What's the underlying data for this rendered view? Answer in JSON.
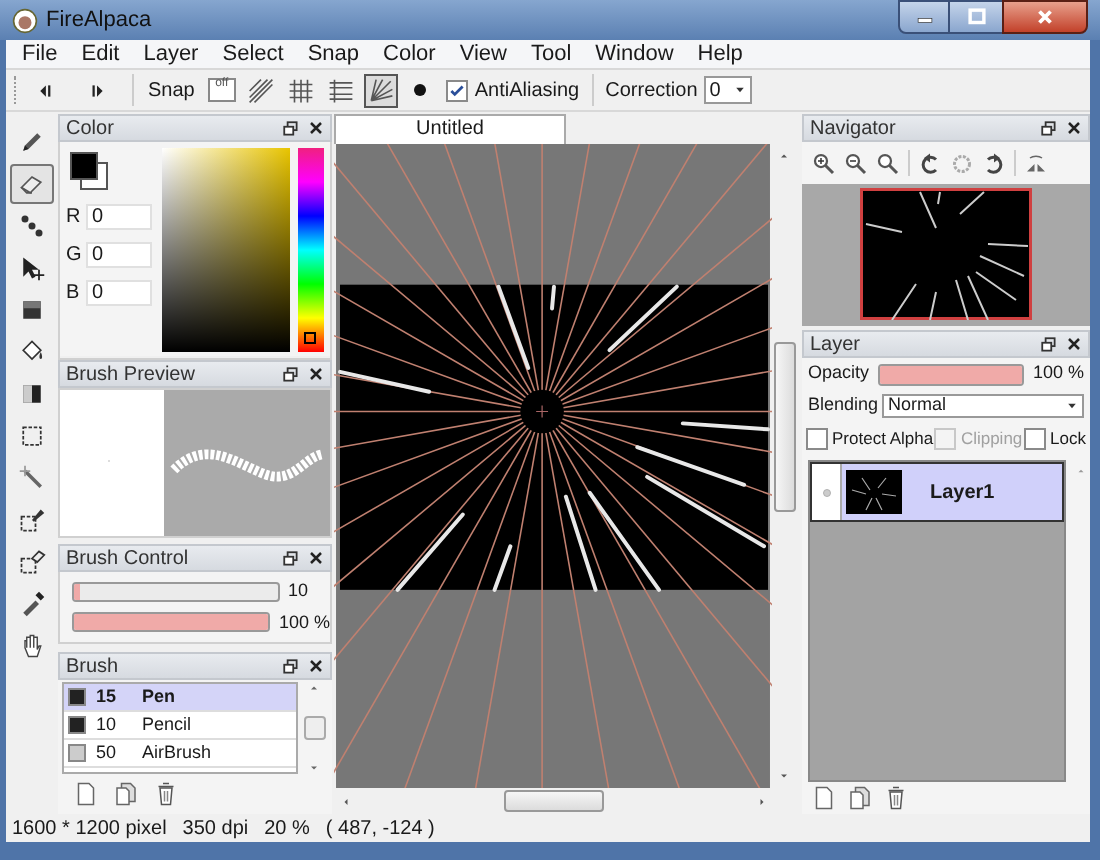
{
  "window": {
    "title": "FireAlpaca"
  },
  "menu": [
    "File",
    "Edit",
    "Layer",
    "Select",
    "Snap",
    "Color",
    "View",
    "Tool",
    "Window",
    "Help"
  ],
  "toolbar": {
    "snap_label": "Snap",
    "snap_modes": [
      {
        "kind": "off",
        "label": "off",
        "selected": false
      },
      {
        "kind": "parallel",
        "selected": false
      },
      {
        "kind": "grid",
        "selected": false
      },
      {
        "kind": "lines",
        "selected": false
      },
      {
        "kind": "radial",
        "selected": true
      }
    ],
    "antialiasing": {
      "label": "AntiAliasing",
      "checked": true
    },
    "correction": {
      "label": "Correction",
      "value": "0"
    }
  },
  "tools": [
    {
      "kind": "pen",
      "selected": false
    },
    {
      "kind": "eraser",
      "selected": true
    },
    {
      "kind": "dots",
      "selected": false
    },
    {
      "kind": "move",
      "selected": false
    },
    {
      "kind": "fill",
      "selected": false
    },
    {
      "kind": "bucket",
      "selected": false
    },
    {
      "kind": "gradient",
      "selected": false
    },
    {
      "kind": "select",
      "selected": false
    },
    {
      "kind": "wand",
      "selected": false
    },
    {
      "kind": "selectpen",
      "selected": false
    },
    {
      "kind": "selecteraser",
      "selected": false
    },
    {
      "kind": "eyedropper",
      "selected": false
    },
    {
      "kind": "hand",
      "selected": false
    }
  ],
  "color_panel": {
    "title": "Color",
    "hue": {
      "level": 0.07
    },
    "channels": [
      {
        "label": "R",
        "value": "0"
      },
      {
        "label": "G",
        "value": "0"
      },
      {
        "label": "B",
        "value": "0"
      }
    ]
  },
  "brush_preview": {
    "title": "Brush Preview"
  },
  "brush_control": {
    "title": "Brush Control",
    "sliders": [
      {
        "level": 0.03,
        "reading": "10"
      },
      {
        "level": 1,
        "reading": "100 %"
      }
    ]
  },
  "brush": {
    "title": "Brush",
    "items": [
      {
        "size": "15",
        "name": "Pen",
        "color": "#222222",
        "selected": true
      },
      {
        "size": "10",
        "name": "Pencil",
        "color": "#222222",
        "selected": false
      },
      {
        "size": "50",
        "name": "AirBrush",
        "color": "#cccccc",
        "selected": false
      }
    ]
  },
  "document_tab": {
    "title": "Untitled"
  },
  "navigator": {
    "title": "Navigator"
  },
  "layer_panel": {
    "title": "Layer",
    "opacity": {
      "label": "Opacity",
      "level": 1,
      "reading": "100 %"
    },
    "blending": {
      "label": "Blending",
      "value": "Normal"
    },
    "options": [
      {
        "label": "Protect Alpha",
        "checked": false,
        "disabled": false
      },
      {
        "label": "Clipping",
        "checked": false,
        "disabled": true
      },
      {
        "label": "Lock",
        "checked": false,
        "disabled": false
      }
    ],
    "layers": [
      {
        "name": "Layer1",
        "selected": true
      }
    ]
  },
  "status_bar": [
    "1600 * 1200 pixel",
    "350 dpi",
    "20 %",
    "( 487, -124 )"
  ]
}
